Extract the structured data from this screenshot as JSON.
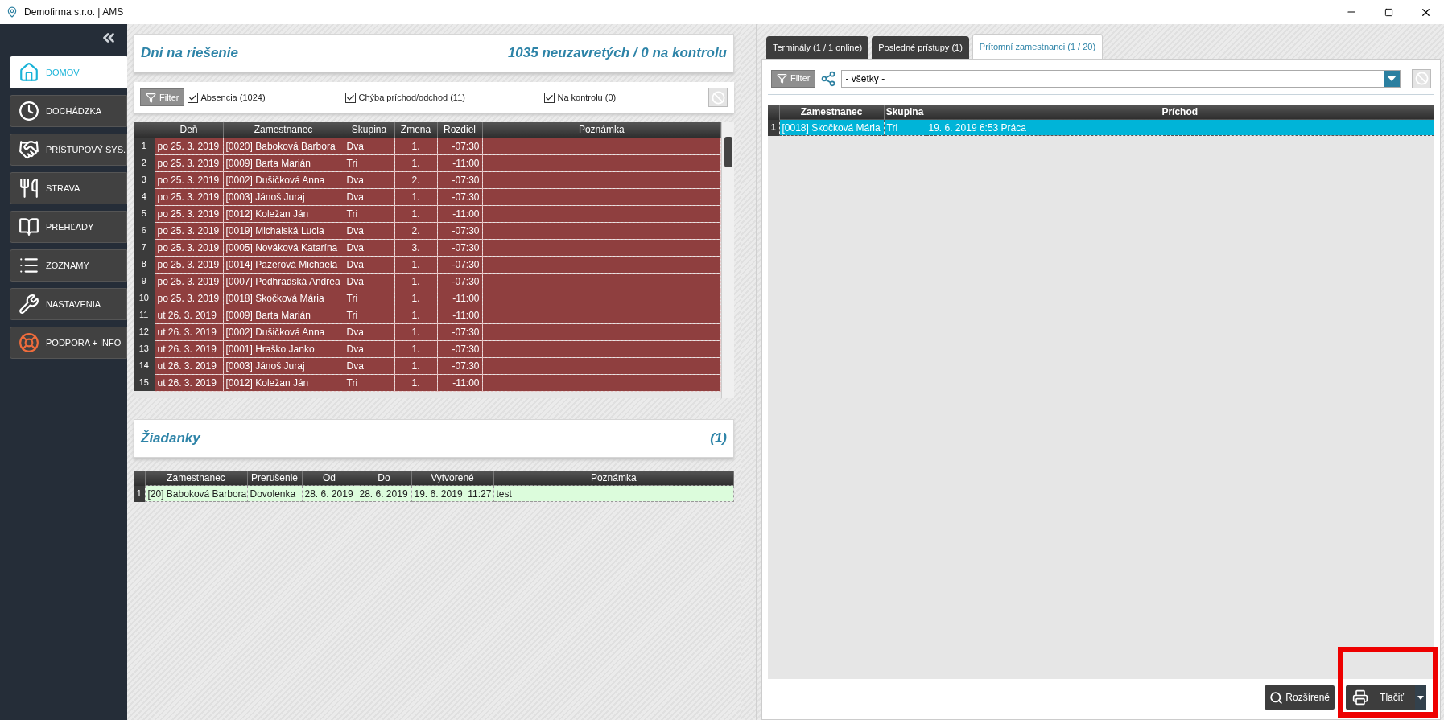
{
  "window": {
    "title": "Demofirma s.r.o. | AMS"
  },
  "sidebar": {
    "items": [
      {
        "label": "DOMOV",
        "selected": true
      },
      {
        "label": "DOCHÁDZKA",
        "selected": false
      },
      {
        "label": "PRÍSTUPOVÝ SYS.",
        "selected": false
      },
      {
        "label": "STRAVA",
        "selected": false
      },
      {
        "label": "PREHĽADY",
        "selected": false
      },
      {
        "label": "ZOZNAMY",
        "selected": false
      },
      {
        "label": "NASTAVENIA",
        "selected": false
      },
      {
        "label": "PODPORA + INFO",
        "selected": false
      }
    ]
  },
  "days_panel": {
    "title": "Dni na riešenie",
    "summary": "1035 neuzavretých / 0 na kontrolu",
    "filter_button": "Filter",
    "filters": [
      {
        "label": "Absencia (1024)",
        "checked": true
      },
      {
        "label": "Chýba príchod/odchod (11)",
        "checked": true
      },
      {
        "label": "Na kontrolu (0)",
        "checked": true
      }
    ],
    "table": {
      "columns": [
        "",
        "Deň",
        "Zamestnanec",
        "Skupina",
        "Zmena",
        "Rozdiel",
        "Poznámka"
      ],
      "rows": [
        [
          "1",
          "po 25. 3. 2019",
          "[0020] Baboková Barbora",
          "Dva",
          "1.",
          "-07:30",
          ""
        ],
        [
          "2",
          "po 25. 3. 2019",
          "[0009] Barta Marián",
          "Tri",
          "1.",
          "-11:00",
          ""
        ],
        [
          "3",
          "po 25. 3. 2019",
          "[0002] Dušičková Anna",
          "Dva",
          "2.",
          "-07:30",
          ""
        ],
        [
          "4",
          "po 25. 3. 2019",
          "[0003] Jánoš Juraj",
          "Dva",
          "1.",
          "-07:30",
          ""
        ],
        [
          "5",
          "po 25. 3. 2019",
          "[0012] Koležan Ján",
          "Tri",
          "1.",
          "-11:00",
          ""
        ],
        [
          "6",
          "po 25. 3. 2019",
          "[0019] Michalská Lucia",
          "Dva",
          "2.",
          "-07:30",
          ""
        ],
        [
          "7",
          "po 25. 3. 2019",
          "[0005] Nováková Katarína",
          "Dva",
          "3.",
          "-07:30",
          ""
        ],
        [
          "8",
          "po 25. 3. 2019",
          "[0014] Pazerová Michaela",
          "Dva",
          "1.",
          "-07:30",
          ""
        ],
        [
          "9",
          "po 25. 3. 2019",
          "[0007] Podhradská Andrea",
          "Dva",
          "1.",
          "-07:30",
          ""
        ],
        [
          "10",
          "po 25. 3. 2019",
          "[0018] Skočková Mária",
          "Tri",
          "1.",
          "-11:00",
          ""
        ],
        [
          "11",
          "ut 26. 3. 2019",
          "[0009] Barta Marián",
          "Tri",
          "1.",
          "-11:00",
          ""
        ],
        [
          "12",
          "ut 26. 3. 2019",
          "[0002] Dušičková Anna",
          "Dva",
          "1.",
          "-07:30",
          ""
        ],
        [
          "13",
          "ut 26. 3. 2019",
          "[0001] Hraško Janko",
          "Dva",
          "1.",
          "-07:30",
          ""
        ],
        [
          "14",
          "ut 26. 3. 2019",
          "[0003] Jánoš Juraj",
          "Dva",
          "1.",
          "-07:30",
          ""
        ],
        [
          "15",
          "ut 26. 3. 2019",
          "[0012] Koležan Ján",
          "Tri",
          "1.",
          "-11:00",
          ""
        ]
      ]
    }
  },
  "requests_panel": {
    "title": "Žiadanky",
    "count": "(1)",
    "table": {
      "columns": [
        "",
        "Zamestnanec",
        "Prerušenie",
        "Od",
        "Do",
        "Vytvorené",
        "Poznámka"
      ],
      "rows": [
        [
          "1",
          "[20] Baboková Barbora",
          "Dovolenka",
          "28. 6. 2019",
          "28. 6. 2019",
          "19. 6. 2019  11:27",
          "test"
        ]
      ]
    }
  },
  "right_panel": {
    "tabs": [
      {
        "label": "Terminály (1 / 1 online)",
        "selected": false
      },
      {
        "label": "Posledné prístupy (1)",
        "selected": false
      },
      {
        "label": "Prítomní zamestnanci (1 / 20)",
        "selected": true
      }
    ],
    "filter_button": "Filter",
    "group_select": {
      "value": "- všetky -"
    },
    "table": {
      "columns": [
        "",
        "Zamestnanec",
        "Skupina",
        "Príchod"
      ],
      "rows": [
        {
          "cells": [
            "1",
            "[0018] Skočková Mária",
            "Tri",
            "19. 6. 2019 6:53 Práca"
          ],
          "selected": true
        }
      ]
    },
    "buttons": [
      {
        "kind": "search",
        "label": "Rozšírené"
      },
      {
        "kind": "print",
        "label": "Tlačiť"
      }
    ]
  }
}
